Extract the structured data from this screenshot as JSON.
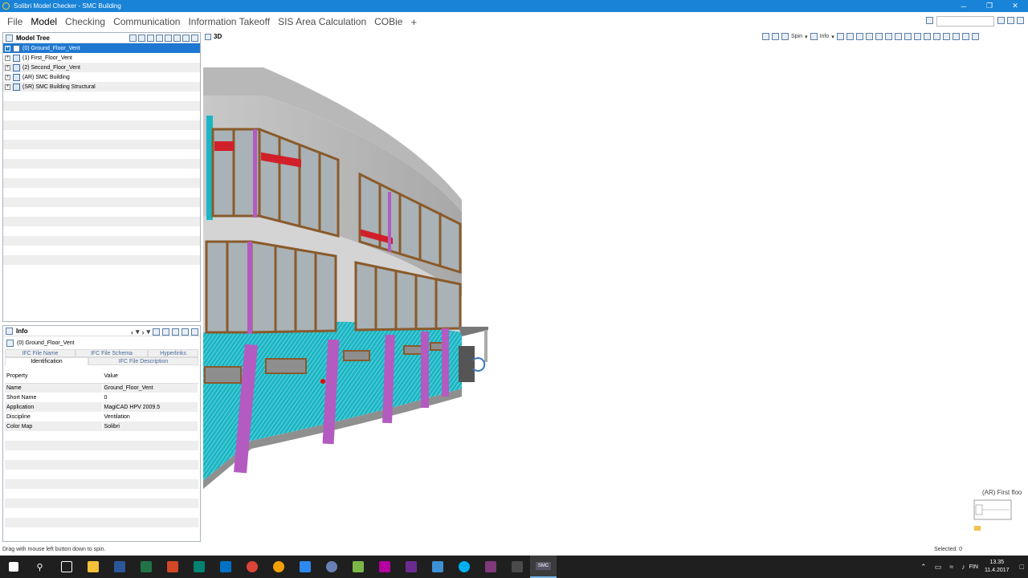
{
  "window": {
    "title": "Solibri Model Checker - SMC Building",
    "minimize": "─",
    "restore": "❐",
    "close": "✕"
  },
  "menu": {
    "items": [
      "File",
      "Model",
      "Checking",
      "Communication",
      "Information Takeoff",
      "SIS Area Calculation",
      "COBie"
    ],
    "active": "Model",
    "plus": "+",
    "search_value": ""
  },
  "model_tree": {
    "title": "Model Tree",
    "items": [
      {
        "label": "(0) Ground_Floor_Vent",
        "selected": true
      },
      {
        "label": "(1) First_Floor_Vent",
        "selected": false
      },
      {
        "label": "(2) Second_Floor_Vent",
        "selected": false
      },
      {
        "label": "(AR) SMC Building",
        "selected": false
      },
      {
        "label": "(SR) SMC Building Structural",
        "selected": false
      }
    ]
  },
  "info": {
    "title": "Info",
    "selected_item": "(0) Ground_Floor_Vent",
    "tabs_row1": [
      "IFC File Name",
      "IFC File Schema",
      "Hyperlinks"
    ],
    "tabs_row2": [
      "Identification",
      "IFC File Description"
    ],
    "active_tab": "Identification",
    "columns": [
      "Property",
      "Value"
    ],
    "rows": [
      {
        "property": "Name",
        "value": "Ground_Floor_Vent"
      },
      {
        "property": "Short Name",
        "value": "0"
      },
      {
        "property": "Application",
        "value": "MagiCAD HPV 2009.5"
      },
      {
        "property": "Discipline",
        "value": "Ventilation"
      },
      {
        "property": "Color Map",
        "value": "Solibri"
      }
    ]
  },
  "view": {
    "title": "3D",
    "spin_label": "Spin",
    "info_label": "Info",
    "minimap_label": "(AR) First floo"
  },
  "status": {
    "left": "Drag with mouse left button down to spin.",
    "right": "Selected: 0"
  },
  "taskbar": {
    "lang": "FIN",
    "time": "13.35",
    "date": "11.4.2017",
    "app_label": "SMC"
  },
  "colors": {
    "title_bar": "#1883d7",
    "selection": "#1e78d2",
    "wall": "#b6b6b6",
    "vent": "#1ab6c4",
    "column": "#b35bc0",
    "frame": "#8a5a2b"
  }
}
